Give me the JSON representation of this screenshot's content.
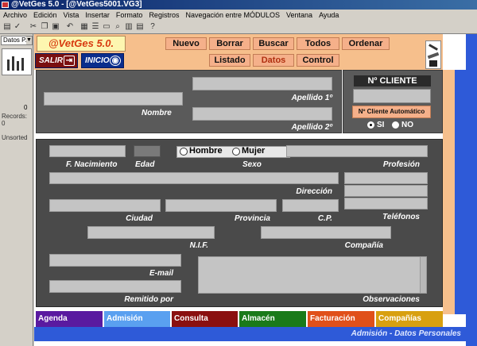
{
  "window": {
    "title": "@VetGes 5.0 - [@VetGes5001.VG3]"
  },
  "menu": [
    "Archivo",
    "Edición",
    "Vista",
    "Insertar",
    "Formato",
    "Registros",
    "Navegación entre MÓDULOS",
    "Ventana",
    "Ayuda"
  ],
  "sidebar": {
    "dropdown": "Datos P...",
    "number": "0",
    "records_label": "Records:",
    "records_value": "0",
    "sort": "Unsorted"
  },
  "app": {
    "logo": "@VetGes 5.0."
  },
  "nav": {
    "nuevo": "Nuevo",
    "borrar": "Borrar",
    "buscar": "Buscar",
    "todos": "Todos",
    "ordenar": "Ordenar",
    "listado": "Listado",
    "datos": "Datos",
    "control": "Control"
  },
  "actions": {
    "salir": "SALIR",
    "inicio": "INICIO"
  },
  "form": {
    "nombre": "Nombre",
    "apellido1": "Apellido 1º",
    "apellido2": "Apellido 2º",
    "cliente_title": "Nº CLIENTE",
    "cliente_auto": "Nº Cliente Automático",
    "si": "SI",
    "no": "NO",
    "hombre": "Hombre",
    "mujer": "Mujer",
    "f_nacimiento": "F. Nacimiento",
    "edad": "Edad",
    "sexo": "Sexo",
    "profesion": "Profesión",
    "direccion": "Dirección",
    "telefonos": "Teléfonos",
    "ciudad": "Ciudad",
    "provincia": "Provincia",
    "cp": "C.P.",
    "nif": "N.I.F.",
    "compania": "Compañía",
    "email": "E-mail",
    "remitido": "Remitido por",
    "observaciones": "Observaciones"
  },
  "tabs": [
    {
      "label": "Agenda",
      "color": "#5a1aa0"
    },
    {
      "label": "Admisión",
      "color": "#5aa0f0"
    },
    {
      "label": "Consulta",
      "color": "#8a1010"
    },
    {
      "label": "Almacén",
      "color": "#1a7a1a"
    },
    {
      "label": "Facturación",
      "color": "#e0501a"
    },
    {
      "label": "Compañías",
      "color": "#d8a010"
    }
  ],
  "status": "Admisión - Datos Personales",
  "colors": {
    "header": "#f6bf8c",
    "accent_blue": "#2e5ad8",
    "panel": "#4a4a4a"
  }
}
